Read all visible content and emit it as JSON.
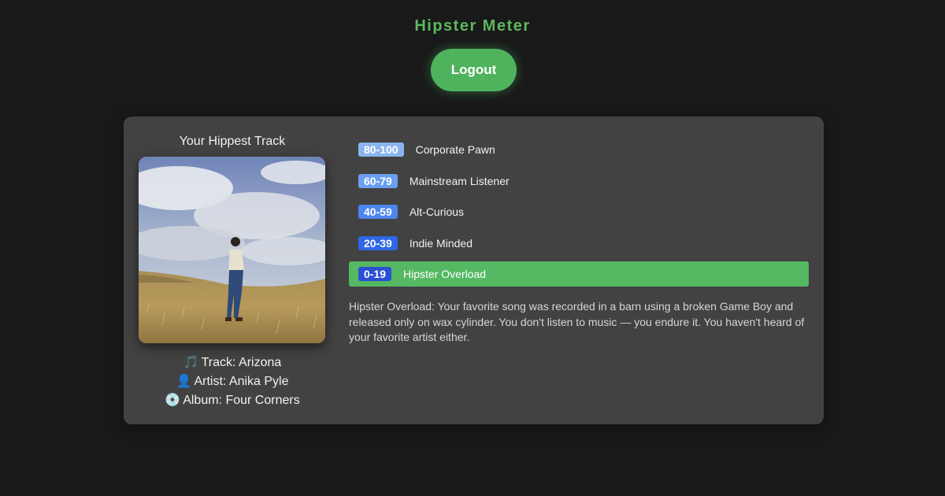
{
  "header": {
    "title": "Hipster Meter",
    "logout_label": "Logout"
  },
  "track": {
    "heading": "Your Hippest Track",
    "track_icon": "🎵",
    "track_line": "Track: Arizona",
    "artist_icon": "👤",
    "artist_line": "Artist: Anika Pyle",
    "album_icon": "💿",
    "album_line": "Album: Four Corners"
  },
  "scale": {
    "tiers": [
      {
        "range": "80-100",
        "label": "Corporate Pawn",
        "badge_color": "#8ab4f0"
      },
      {
        "range": "60-79",
        "label": "Mainstream Listener",
        "badge_color": "#6b9ff0"
      },
      {
        "range": "40-59",
        "label": "Alt-Curious",
        "badge_color": "#4c86ee"
      },
      {
        "range": "20-39",
        "label": "Indie Minded",
        "badge_color": "#2f67e6"
      },
      {
        "range": "0-19",
        "label": "Hipster Overload",
        "badge_color": "#2a4fd6"
      }
    ],
    "active_index": 4
  },
  "description": "Hipster Overload: Your favorite song was recorded in a barn using a broken Game Boy and released only on wax cylinder. You don't listen to music — you endure it. You haven't heard of your favorite artist either.",
  "colors": {
    "accent": "#5cb85c",
    "background": "#191919",
    "card": "#424242",
    "active_tier": "#55b862"
  }
}
